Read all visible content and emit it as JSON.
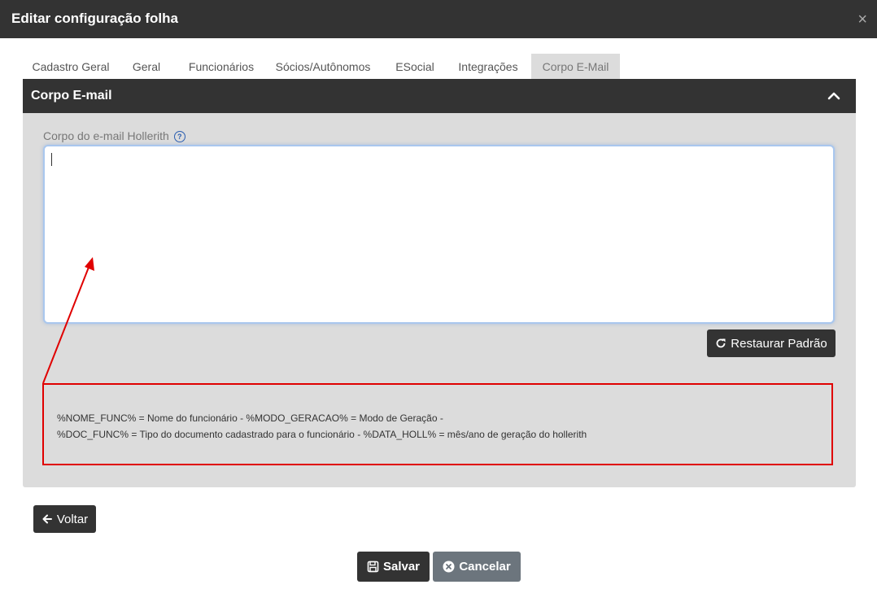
{
  "window": {
    "title": "Editar configuração folha",
    "close_icon": "×"
  },
  "tabs": [
    {
      "label": "Cadastro Geral",
      "active": false
    },
    {
      "label": "Geral",
      "active": false
    },
    {
      "label": "Funcionários",
      "active": false
    },
    {
      "label": "Sócios/Autônomos",
      "active": false
    },
    {
      "label": "ESocial",
      "active": false
    },
    {
      "label": "Integrações",
      "active": false
    },
    {
      "label": "Corpo E-Mail",
      "active": true
    }
  ],
  "panel": {
    "title": "Corpo E-mail",
    "field_label": "Corpo do e-mail Hollerith",
    "help_icon": "?",
    "textarea_value": "",
    "restore_label": "Restaurar Padrão",
    "info_lines": [
      "%NOME_FUNC% = Nome do funcionário - %MODO_GERACAO% = Modo de Geração -",
      "%DOC_FUNC% = Tipo do documento cadastrado para o funcionário - %DATA_HOLL% = mês/ano de geração do hollerith"
    ]
  },
  "footer": {
    "back_label": "Voltar",
    "save_label": "Salvar",
    "cancel_label": "Cancelar"
  },
  "colors": {
    "header_bg": "#333333",
    "panel_bg": "#dcdcdc",
    "annotation_red": "#e00000",
    "cancel_bg": "#6c757d"
  }
}
